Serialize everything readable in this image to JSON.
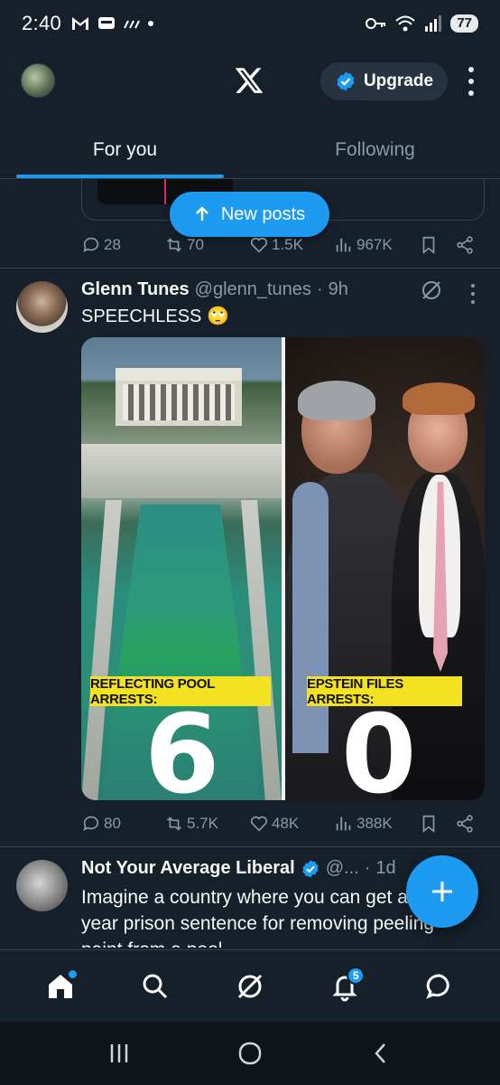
{
  "status_bar": {
    "time": "2:40",
    "battery": "77",
    "icons": [
      "gmail-icon",
      "message-icon",
      "signal-strength-icon",
      "key-icon",
      "wifi-icon",
      "cell-signal-icon"
    ]
  },
  "header": {
    "logo": "x-logo",
    "upgrade_label": "Upgrade"
  },
  "tabs": [
    {
      "label": "For you",
      "active": true
    },
    {
      "label": "Following",
      "active": false
    }
  ],
  "new_posts_label": "New posts",
  "prev_tweet": {
    "replies": "28",
    "reposts": "70",
    "likes": "1.5K",
    "views": "967K"
  },
  "tweet": {
    "name": "Glenn Tunes",
    "handle": "@glenn_tunes",
    "sep": "·",
    "time": "9h",
    "text": "SPEECHLESS 🙄",
    "image": {
      "left_label": "REFLECTING POOL ARRESTS:",
      "left_number": "6",
      "right_label": "EPSTEIN FILES ARRESTS:",
      "right_number": "0"
    },
    "replies": "80",
    "reposts": "5.7K",
    "likes": "48K",
    "views": "388K"
  },
  "tweet3": {
    "name": "Not Your Average Liberal",
    "handle": "@...",
    "sep": "·",
    "time": "1d",
    "text": "Imagine a country where you can get a year prison sentence for removing peeling paint from a pool"
  },
  "bottom_nav": {
    "notifications_count": "5"
  },
  "colors": {
    "background": "#15202b",
    "accent": "#1d9bf0",
    "secondary_text": "#8b98a5",
    "label_yellow": "#f2e21f"
  }
}
